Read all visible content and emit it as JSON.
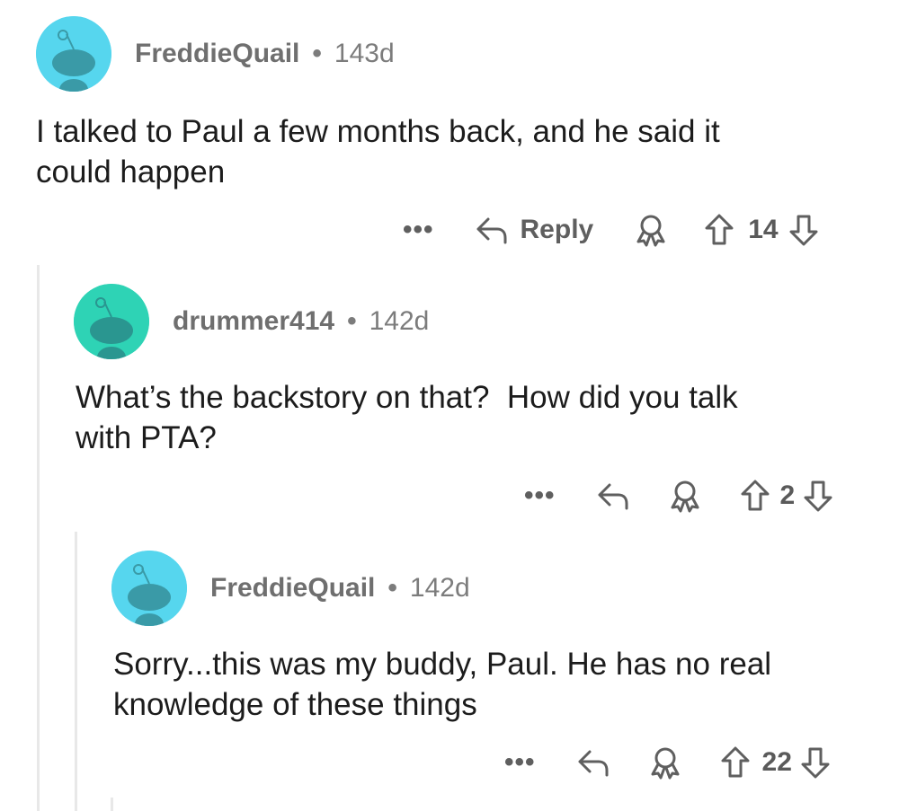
{
  "comments": [
    {
      "username": "FreddieQuail",
      "separator": "•",
      "age": "143d",
      "body": "I talked to Paul a few months back, and he said it\ncould happen",
      "more_label": "•••",
      "reply_label": "Reply",
      "vote_count": "14",
      "avatar_color": "#56d6ee"
    },
    {
      "username": "drummer414",
      "separator": "•",
      "age": "142d",
      "body": "What’s the backstory on that?  How did you talk\nwith PTA?",
      "more_label": "•••",
      "vote_count": "2",
      "avatar_color": "#2ed3b5"
    },
    {
      "username": "FreddieQuail",
      "separator": "•",
      "age": "142d",
      "body": "Sorry...this was my buddy, Paul. He has no real\nknowledge of these things",
      "more_label": "•••",
      "vote_count": "22",
      "avatar_color": "#56d6ee"
    }
  ],
  "icons": {
    "avatar": "snoo-avatar-icon",
    "more": "more-options-icon",
    "reply": "reply-arrow-icon",
    "award": "award-icon",
    "upvote": "upvote-arrow-icon",
    "downvote": "downvote-arrow-icon"
  }
}
